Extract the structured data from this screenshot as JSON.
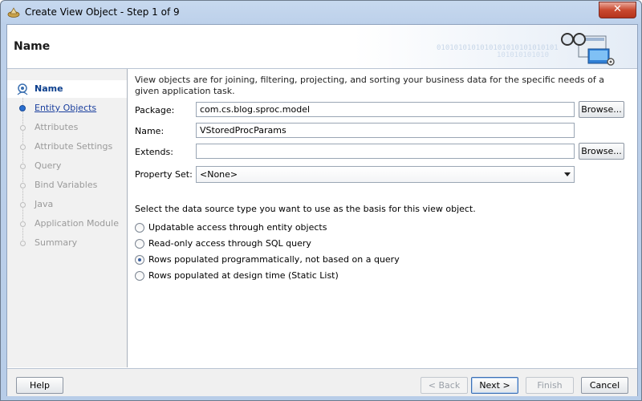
{
  "window": {
    "title": "Create View Object - Step 1 of 9",
    "close_label": "✕"
  },
  "header": {
    "title": "Name",
    "binary_text_1": "0101010101010101010101010101",
    "binary_text_2": "101010101010"
  },
  "nav": {
    "items": [
      {
        "label": "Name",
        "state": "active"
      },
      {
        "label": "Entity Objects",
        "state": "link"
      },
      {
        "label": "Attributes",
        "state": "disabled"
      },
      {
        "label": "Attribute Settings",
        "state": "disabled"
      },
      {
        "label": "Query",
        "state": "disabled"
      },
      {
        "label": "Bind Variables",
        "state": "disabled"
      },
      {
        "label": "Java",
        "state": "disabled"
      },
      {
        "label": "Application Module",
        "state": "disabled"
      },
      {
        "label": "Summary",
        "state": "disabled"
      }
    ]
  },
  "main": {
    "description": "View objects are for joining, filtering, projecting, and sorting your business data for the specific needs of a given application task.",
    "package": {
      "label": "Package:",
      "value": "com.cs.blog.sproc.model",
      "browse_label": "Browse..."
    },
    "name": {
      "label": "Name:",
      "value": "VStoredProcParams"
    },
    "extends": {
      "label": "Extends:",
      "value": "",
      "browse_label": "Browse..."
    },
    "property_set": {
      "label": "Property Set:",
      "value": "<None>"
    },
    "datasource_prompt": "Select the data source type you want to use as the basis for this view object.",
    "options": [
      {
        "label": "Updatable access through entity objects",
        "selected": false
      },
      {
        "label": "Read-only access through SQL query",
        "selected": false
      },
      {
        "label": "Rows populated programmatically, not based on a query",
        "selected": true
      },
      {
        "label": "Rows populated at design time (Static List)",
        "selected": false
      }
    ]
  },
  "footer": {
    "help_label": "Help",
    "back_label": "< Back",
    "next_label": "Next >",
    "finish_label": "Finish",
    "cancel_label": "Cancel"
  },
  "colors": {
    "title_bar": "#c7d9ef",
    "accent": "#0b3e8d",
    "close_button": "#c9492f"
  }
}
